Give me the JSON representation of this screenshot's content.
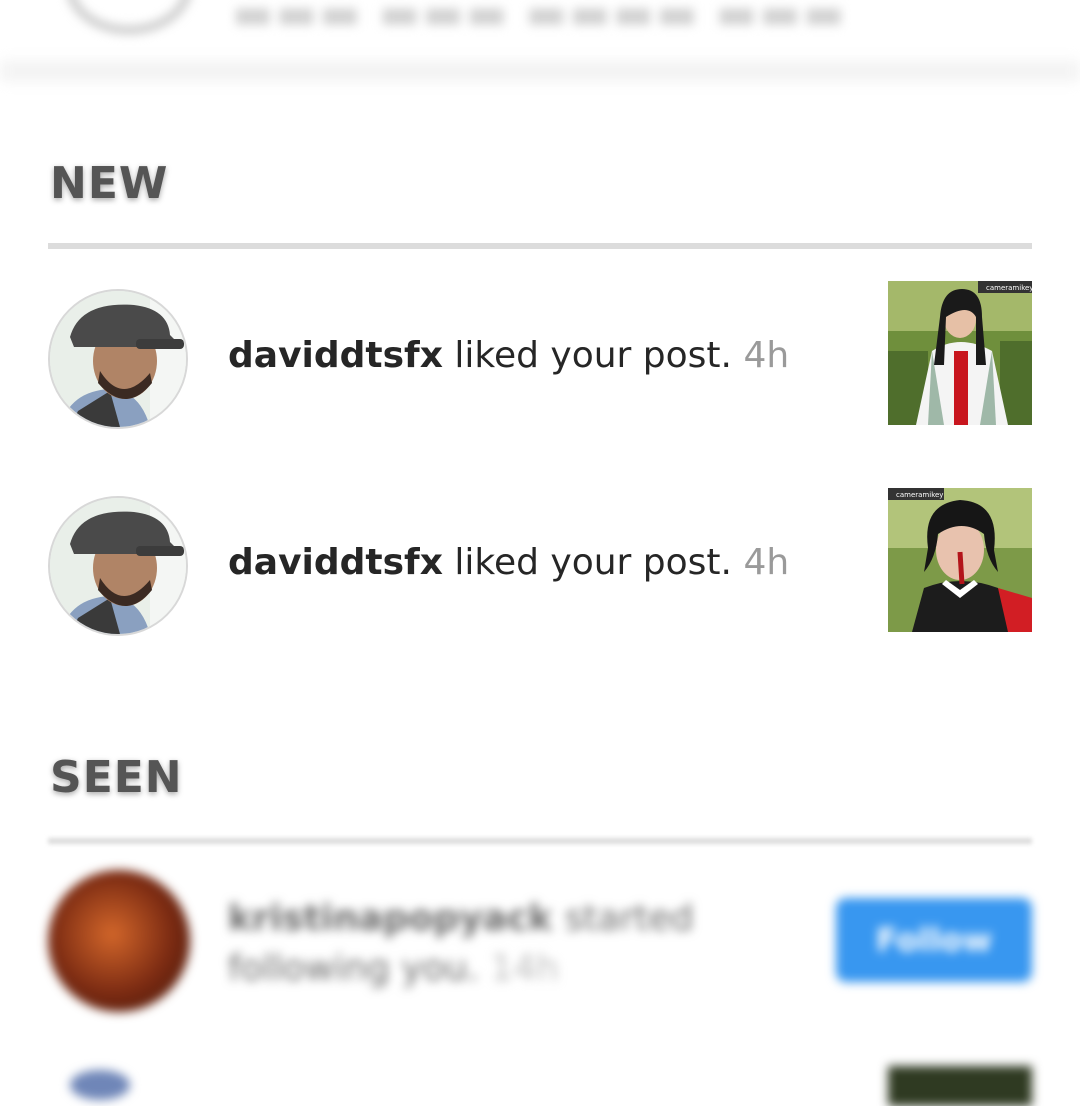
{
  "top": {
    "partial_text": ""
  },
  "sections": {
    "new": {
      "label": "NEW"
    },
    "seen": {
      "label": "SEEN"
    }
  },
  "new_items": [
    {
      "username": "daviddtsfx",
      "action": "liked your post.",
      "time": "4h",
      "avatar_icon": "user-avatar",
      "thumb_badge": "cameramikey"
    },
    {
      "username": "daviddtsfx",
      "action": "liked your post.",
      "time": "4h",
      "avatar_icon": "user-avatar",
      "thumb_badge": "cameramikey"
    }
  ],
  "seen_items": [
    {
      "username": "kristinapopyack",
      "action_line1": "started",
      "action_line2": "following you.",
      "time": "14h",
      "button": "Follow"
    }
  ],
  "colors": {
    "follow_button": "#3897f0",
    "divider": "#dcdcdc",
    "time": "#9a9a9a"
  }
}
